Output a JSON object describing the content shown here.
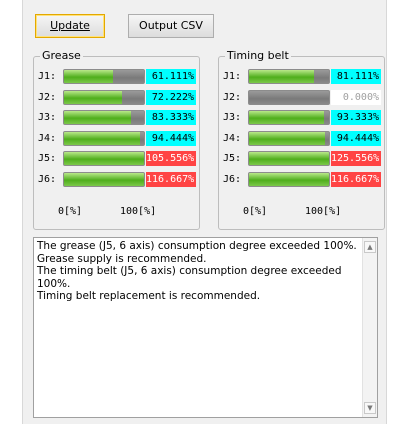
{
  "toolbar": {
    "update_label": "Update",
    "output_csv_label": "Output CSV"
  },
  "grease": {
    "title": "Grease",
    "axis_min": "0[%]",
    "axis_max": "100[%]",
    "rows": [
      {
        "label": "J1:",
        "value": "61.111%",
        "fraction": 0.61111,
        "status": "normal"
      },
      {
        "label": "J2:",
        "value": "72.222%",
        "fraction": 0.72222,
        "status": "normal"
      },
      {
        "label": "J3:",
        "value": "83.333%",
        "fraction": 0.83333,
        "status": "normal"
      },
      {
        "label": "J4:",
        "value": "94.444%",
        "fraction": 0.94444,
        "status": "normal"
      },
      {
        "label": "J5:",
        "value": "105.556%",
        "fraction": 1.05556,
        "status": "over"
      },
      {
        "label": "J6:",
        "value": "116.667%",
        "fraction": 1.16667,
        "status": "over"
      }
    ]
  },
  "timing_belt": {
    "title": "Timing belt",
    "axis_min": "0[%]",
    "axis_max": "100[%]",
    "rows": [
      {
        "label": "J1:",
        "value": "81.111%",
        "fraction": 0.81111,
        "status": "normal"
      },
      {
        "label": "J2:",
        "value": "0.000%",
        "fraction": 0.0,
        "status": "none"
      },
      {
        "label": "J3:",
        "value": "93.333%",
        "fraction": 0.93333,
        "status": "normal"
      },
      {
        "label": "J4:",
        "value": "94.444%",
        "fraction": 0.94444,
        "status": "normal"
      },
      {
        "label": "J5:",
        "value": "125.556%",
        "fraction": 1.25556,
        "status": "over"
      },
      {
        "label": "J6:",
        "value": "116.667%",
        "fraction": 1.16667,
        "status": "over"
      }
    ]
  },
  "colors": {
    "normal_bg": "#00ffff",
    "over_bg": "#ff4444",
    "none_bg": "#ffffff",
    "none_text": "#a0a0a0"
  },
  "messages": {
    "text": "The grease (J5, 6 axis) consumption degree exceeded 100%.\nGrease supply is recommended.\nThe timing belt (J5, 6 axis) consumption degree exceeded 100%.\nTiming belt replacement is recommended."
  },
  "icons": {
    "scroll_up": "chevron-up-icon",
    "scroll_down": "chevron-down-icon"
  }
}
